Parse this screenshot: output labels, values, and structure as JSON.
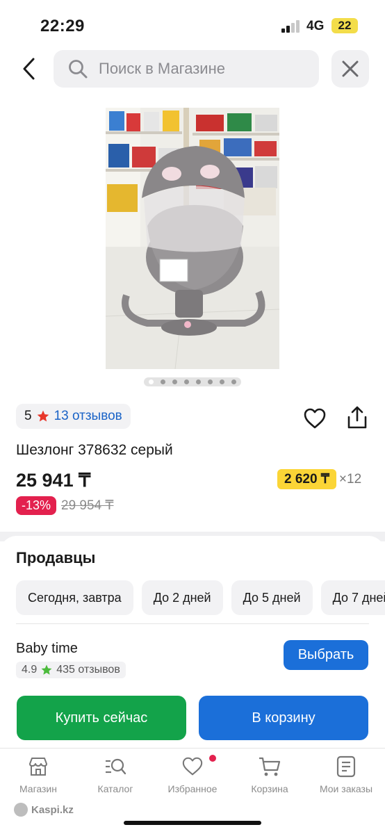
{
  "status_bar": {
    "time": "22:29",
    "network": "4G",
    "battery": "22"
  },
  "search": {
    "placeholder": "Поиск в Магазине"
  },
  "icons": {
    "back": "chevron-left-icon",
    "search": "search-icon",
    "close": "close-icon",
    "heart": "heart-icon",
    "share": "share-icon",
    "star": "star-icon"
  },
  "gallery": {
    "slide_count": 8,
    "active_index": 0
  },
  "product": {
    "rating": "5",
    "reviews": "13 отзывов",
    "title": "Шезлонг 378632 серый",
    "price": "25 941 ₸",
    "installment_price": "2 620 ₸",
    "installment_months": "×12",
    "discount": "-13%",
    "old_price": "29 954 ₸"
  },
  "sellers": {
    "title": "Продавцы",
    "filters": [
      "Сегодня, завтра",
      "До 2 дней",
      "До 5 дней",
      "До 7 дней"
    ],
    "seller": {
      "name": "Baby time",
      "rating": "4.9",
      "reviews": "435 отзывов"
    },
    "choose_label": "Выбрать",
    "buy_now_label": "Купить сейчас",
    "cart_label": "В корзину"
  },
  "bottom_nav": [
    {
      "label": "Магазин",
      "icon": "store-icon"
    },
    {
      "label": "Каталог",
      "icon": "catalog-search-icon"
    },
    {
      "label": "Избранное",
      "icon": "heart-icon"
    },
    {
      "label": "Корзина",
      "icon": "cart-icon"
    },
    {
      "label": "Мои заказы",
      "icon": "orders-icon"
    }
  ],
  "watermark": "Kaspi.kz",
  "colors": {
    "accent_blue": "#1b6fd9",
    "buy_green": "#13a34a",
    "discount_red": "#e3214e",
    "installment_yellow": "#fbd536",
    "star_red": "#e8372b",
    "star_green": "#4cbb3c"
  }
}
